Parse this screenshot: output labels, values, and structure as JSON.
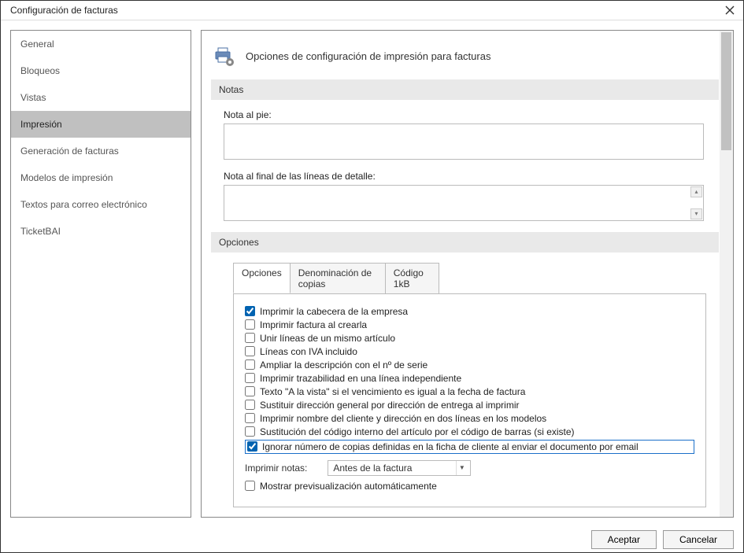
{
  "window": {
    "title": "Configuración de facturas"
  },
  "sidebar": {
    "items": [
      {
        "label": "General"
      },
      {
        "label": "Bloqueos"
      },
      {
        "label": "Vistas"
      },
      {
        "label": "Impresión"
      },
      {
        "label": "Generación de facturas"
      },
      {
        "label": "Modelos de impresión"
      },
      {
        "label": "Textos para correo electrónico"
      },
      {
        "label": "TicketBAI"
      }
    ],
    "selected_index": 3
  },
  "main": {
    "header": "Opciones de configuración de impresión para facturas",
    "notes_section": "Notas",
    "footer_note_label": "Nota al pie:",
    "footer_note_value": "",
    "endlines_note_label": "Nota al final de las líneas de detalle:",
    "endlines_note_value": "",
    "options_section": "Opciones",
    "tabs": [
      {
        "label": "Opciones"
      },
      {
        "label": "Denominación de copias"
      },
      {
        "label": "Código 1kB"
      }
    ],
    "checks": [
      {
        "label": "Imprimir la cabecera de la empresa",
        "checked": true
      },
      {
        "label": "Imprimir factura al crearla",
        "checked": false
      },
      {
        "label": "Unir líneas de un mismo artículo",
        "checked": false
      },
      {
        "label": "Líneas con IVA incluido",
        "checked": false
      },
      {
        "label": "Ampliar la descripción con el nº de serie",
        "checked": false
      },
      {
        "label": "Imprimir trazabilidad en una línea independiente",
        "checked": false
      },
      {
        "label": "Texto \"A la vista\" si el vencimiento es igual a la fecha de factura",
        "checked": false
      },
      {
        "label": "Sustituir dirección general por dirección de entrega al imprimir",
        "checked": false
      },
      {
        "label": "Imprimir nombre del cliente y dirección en dos líneas en los modelos",
        "checked": false
      },
      {
        "label": "Sustitución del código interno del artículo por el código de barras (si existe)",
        "checked": false
      },
      {
        "label": "Ignorar número de copias definidas en la ficha de cliente al enviar el documento por email",
        "checked": true,
        "highlight": true
      }
    ],
    "print_notes_label": "Imprimir notas:",
    "print_notes_value": "Antes de la factura",
    "preview_check": {
      "label": "Mostrar previsualización automáticamente",
      "checked": false
    }
  },
  "footer": {
    "accept": "Aceptar",
    "cancel": "Cancelar"
  }
}
